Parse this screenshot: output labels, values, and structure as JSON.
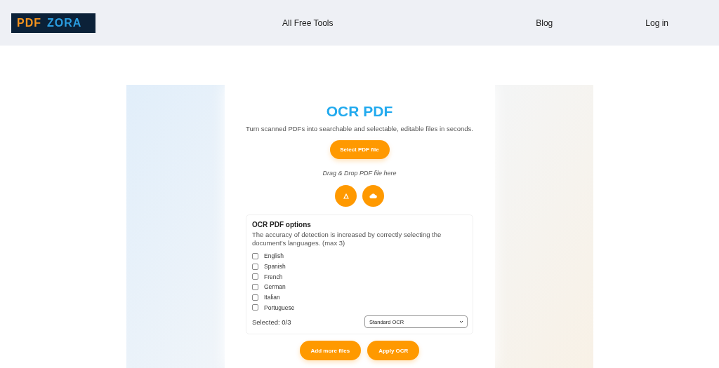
{
  "header": {
    "logo": {
      "part_1": "PDF",
      "part_2": "ZORA"
    },
    "nav": [
      "All Free Tools",
      "Blog",
      "Log in"
    ]
  },
  "tool": {
    "title": "OCR PDF",
    "subtitle": "Turn scanned PDFs into searchable and selectable, editable files in seconds.",
    "select_button": "Select PDF file",
    "drop_hint": "Drag & Drop PDF file here",
    "options": {
      "heading": "OCR PDF options",
      "description": "The accuracy of detection is increased by correctly selecting the document's languages. (max 3)",
      "languages": [
        {
          "label": "English",
          "checked": false
        },
        {
          "label": "Spanish",
          "checked": false
        },
        {
          "label": "French",
          "checked": false
        },
        {
          "label": "German",
          "checked": false
        },
        {
          "label": "Italian",
          "checked": false
        },
        {
          "label": "Portuguese",
          "checked": false
        }
      ],
      "selected_count": "Selected: 0/3",
      "mode": "Standard OCR"
    },
    "buttons": [
      "Add more files",
      "Apply OCR"
    ]
  }
}
